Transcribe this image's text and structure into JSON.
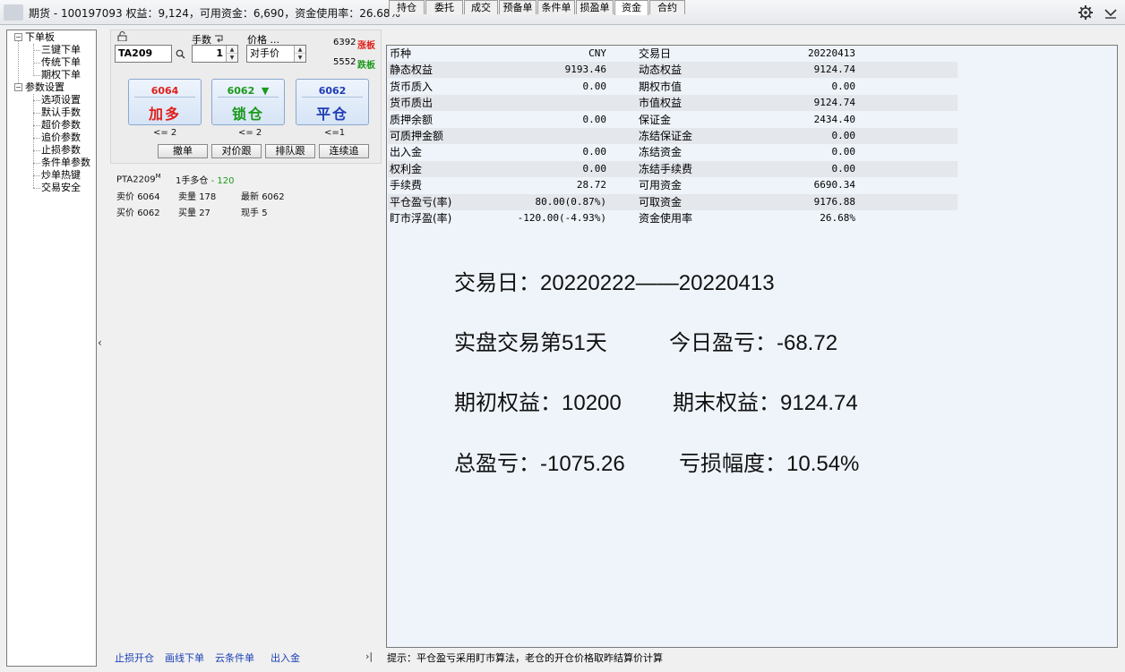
{
  "window": {
    "title": "期货 - 100197093  权益：9,124，可用资金：6,690，资金使用率：26.68%"
  },
  "tree": {
    "group1": "下单板",
    "group1_items": [
      "三键下单",
      "传统下单",
      "期权下单"
    ],
    "group2": "参数设置",
    "group2_items": [
      "选项设置",
      "默认手数",
      "超价参数",
      "追价参数",
      "止损参数",
      "条件单参数",
      "炒单热键",
      "交易安全"
    ]
  },
  "order": {
    "lots_label": "手数",
    "price_label": "价格 ...",
    "symbol": "TA209",
    "lots": "1",
    "price_mode": "对手价",
    "limit_up_price": "6392",
    "limit_up_label": "涨板",
    "limit_down_price": "5552",
    "limit_down_label": "跌板",
    "buttons": [
      {
        "price": "6064",
        "label": "加多",
        "limit": "<= 2",
        "color": "#e0201b"
      },
      {
        "price": "6062",
        "label": "锁仓",
        "limit": "<= 2",
        "color": "#1b9a1b",
        "arrow": "▼"
      },
      {
        "price": "6062",
        "label": "平仓",
        "limit": "<=1",
        "color": "#1f3db5"
      }
    ],
    "small_buttons": [
      "撤单",
      "对价跟",
      "排队跟",
      "连续追"
    ]
  },
  "quote": {
    "contract": "PTA2209",
    "contract_mark": "M",
    "position": "1手多仓",
    "position_pnl": "- 120",
    "ask_label": "卖价",
    "ask": "6064",
    "ask_vol_label": "卖量",
    "ask_vol": "178",
    "last_label": "最新",
    "last": "6062",
    "bid_label": "买价",
    "bid": "6062",
    "bid_vol_label": "买量",
    "bid_vol": "27",
    "cur_vol_label": "现手",
    "cur_vol": "5"
  },
  "bottom_links": [
    "止损开仓",
    "画线下单",
    "云条件单",
    "出入金"
  ],
  "tabs": [
    "持仓",
    "委托",
    "成交",
    "预备单",
    "条件单",
    "损盈单",
    "资金",
    "合约"
  ],
  "active_tab": "资金",
  "funds": [
    [
      "币种",
      "CNY",
      "交易日",
      "20220413"
    ],
    [
      "静态权益",
      "9193.46",
      "动态权益",
      "9124.74"
    ],
    [
      "货币质入",
      "0.00",
      "期权市值",
      "0.00"
    ],
    [
      "货币质出",
      "",
      "市值权益",
      "9124.74"
    ],
    [
      "质押余额",
      "0.00",
      "保证金",
      "2434.40"
    ],
    [
      "可质押金额",
      "",
      "冻结保证金",
      "0.00"
    ],
    [
      "出入金",
      "0.00",
      "冻结资金",
      "0.00"
    ],
    [
      "权利金",
      "0.00",
      "冻结手续费",
      "0.00"
    ],
    [
      "手续费",
      "28.72",
      "可用资金",
      "6690.34"
    ],
    [
      "平仓盈亏(率)",
      "80.00(0.87%)",
      "可取资金",
      "9176.88"
    ],
    [
      "盯市浮盈(率)",
      "-120.00(-4.93%)",
      "资金使用率",
      "26.68%"
    ]
  ],
  "summary": {
    "line1": "交易日：20220222——20220413",
    "line2a": "实盘交易第51天",
    "line2b": "今日盈亏：-68.72",
    "line3a": "期初权益：10200",
    "line3b": "期末权益：9124.74",
    "line4a": "总盈亏：-1075.26",
    "line4b": "亏损幅度：10.54%"
  },
  "hint": "提示：平仓盈亏采用盯市算法，老仓的开仓价格取昨结算价计算"
}
